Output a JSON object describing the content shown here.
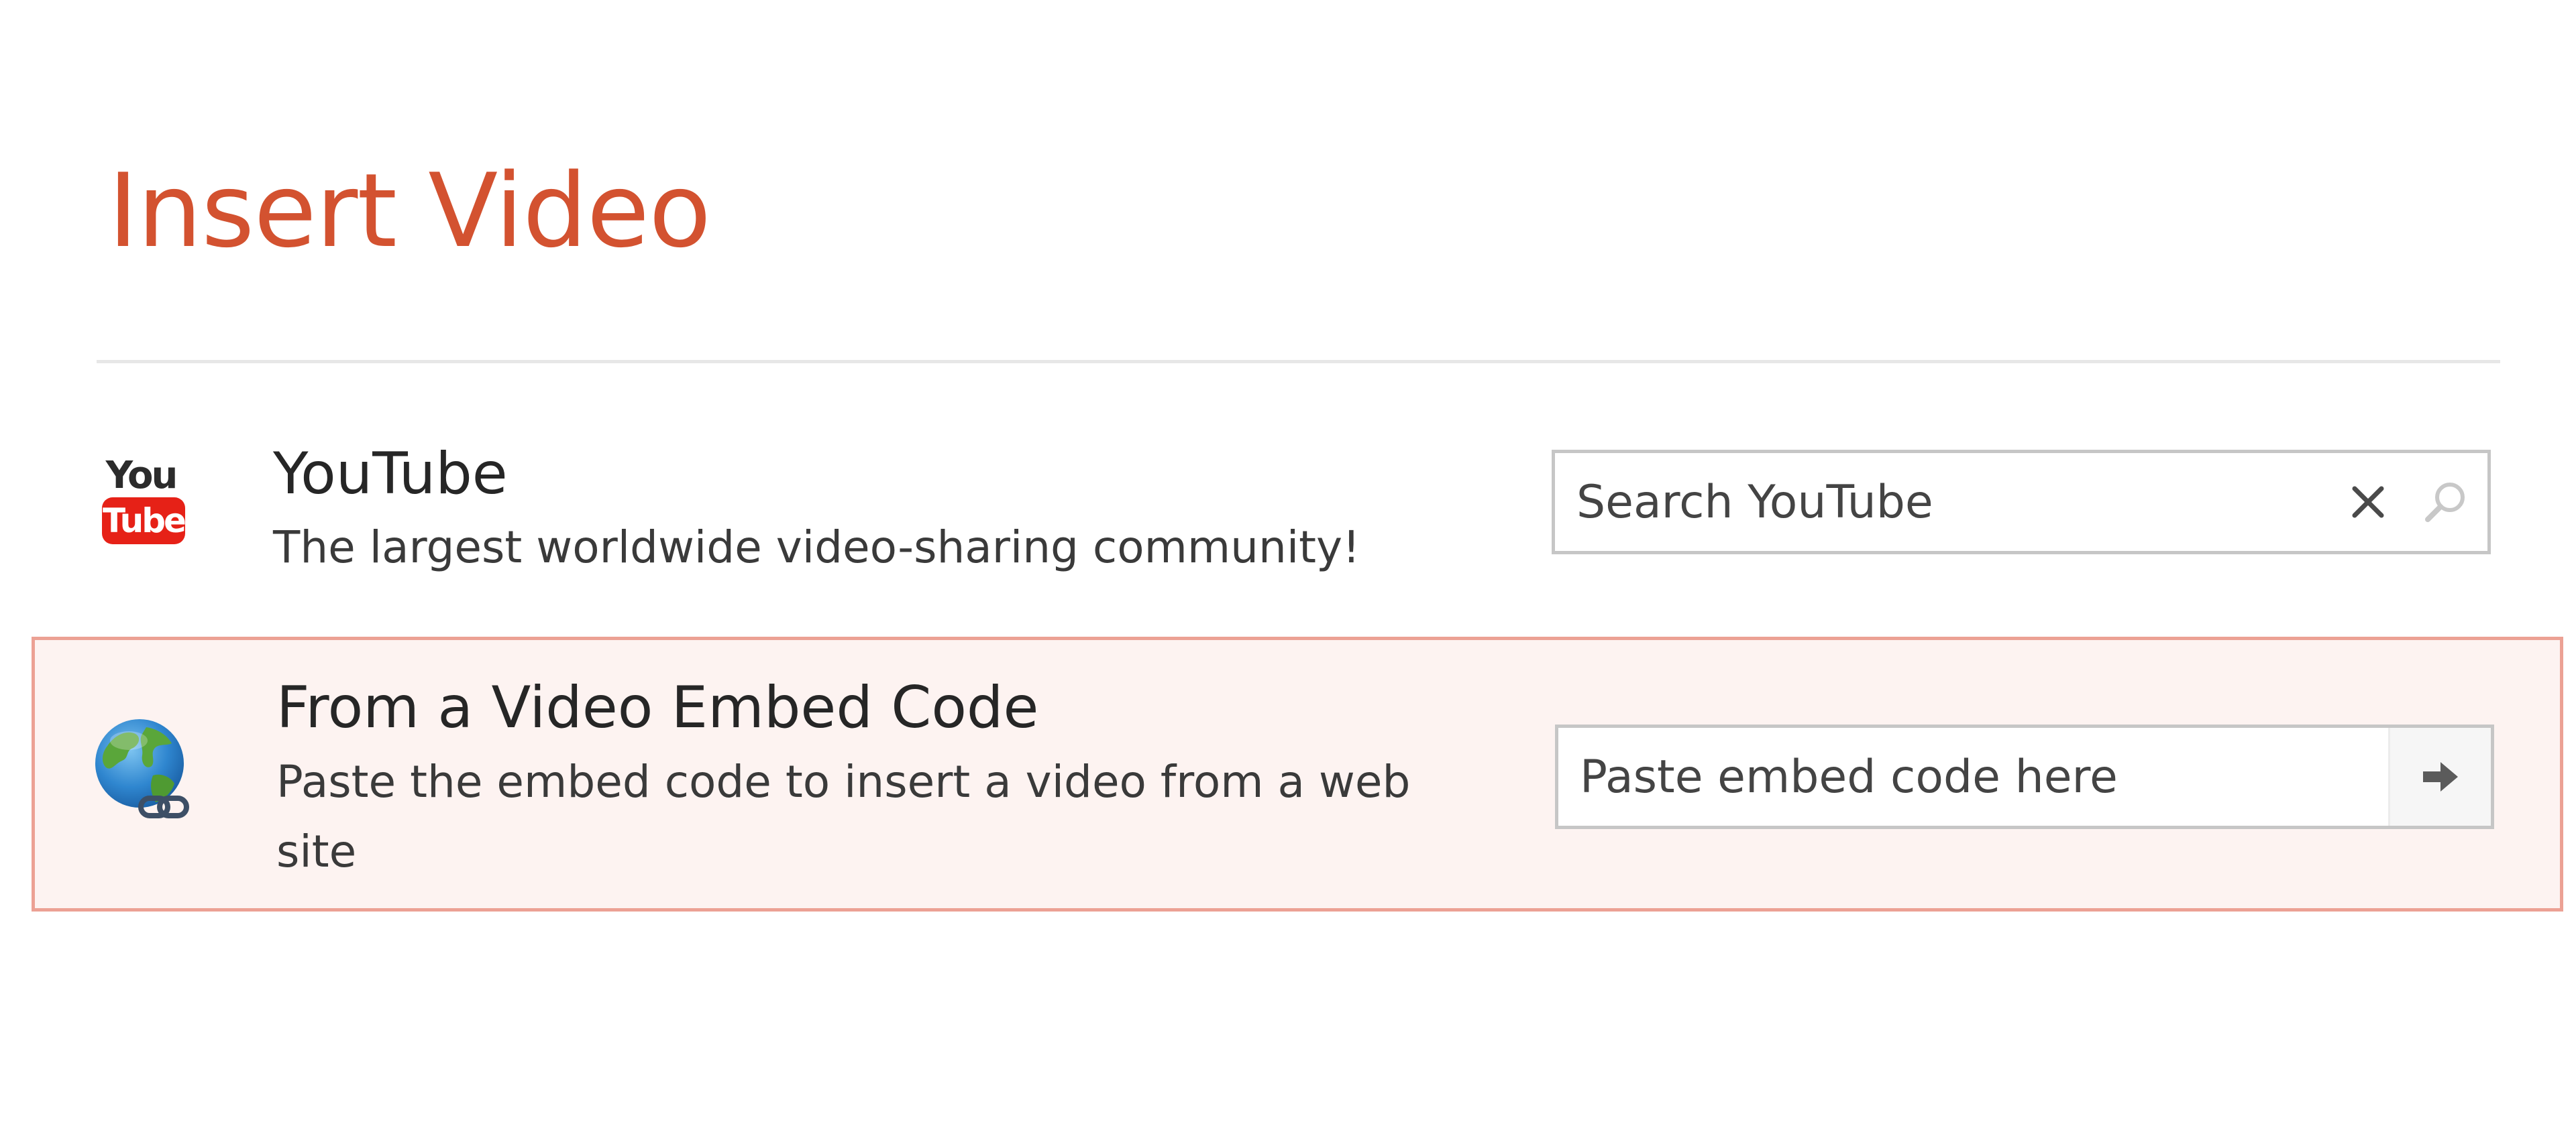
{
  "dialog": {
    "title": "Insert Video"
  },
  "providers": {
    "youtube": {
      "name": "YouTube",
      "description": "The largest worldwide video-sharing community!",
      "logo_text_top": "You",
      "logo_text_bottom": "Tube",
      "search_placeholder": "Search YouTube",
      "search_value": "",
      "clear_icon": "close-icon",
      "search_icon": "search-icon",
      "logo_color": "#e62117"
    },
    "embed": {
      "name": "From a Video Embed Code",
      "description": "Paste the embed code to insert a video from a web site",
      "input_placeholder": "Paste embed code here",
      "input_value": "",
      "icon": "globe-link-icon",
      "submit_icon": "arrow-right-icon",
      "selected": true
    }
  },
  "colors": {
    "title": "#d35230",
    "selected_row_bg": "#fdf3f1",
    "selected_row_border": "#eca194"
  }
}
